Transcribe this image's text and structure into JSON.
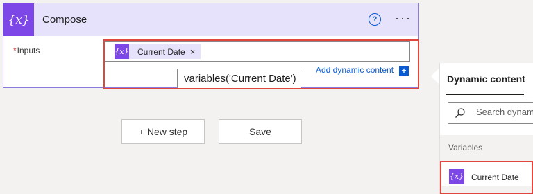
{
  "action_card": {
    "title": "Compose",
    "header_icon": "{x}",
    "help_icon": "?",
    "more_icon": "···",
    "inputs_label": "Inputs",
    "required_mark": "*",
    "token": {
      "icon": "{x}",
      "label": "Current Date",
      "remove": "×"
    },
    "expression_text": "variables('Current Date')",
    "add_dynamic_label": "Add dynamic content",
    "add_dynamic_icon": "+"
  },
  "buttons": {
    "new_step": "+ New step",
    "save": "Save"
  },
  "dynamic_panel": {
    "tab": "Dynamic content",
    "search_placeholder": "Search dynamic content",
    "section_label": "Variables",
    "items": [
      {
        "icon": "{x}",
        "label": "Current Date"
      }
    ]
  },
  "colors": {
    "accent_purple": "#7d46e6",
    "header_bg": "#e7e2fb",
    "link_blue": "#0a5ad1",
    "highlight_red": "#e0463e"
  }
}
